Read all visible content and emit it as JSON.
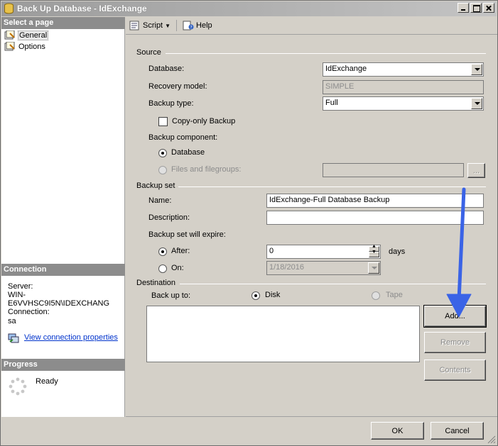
{
  "window": {
    "title": "Back Up Database - IdExchange"
  },
  "left": {
    "select_page_header": "Select a page",
    "pages": [
      {
        "label": "General",
        "icon": "page-icon",
        "selected": true
      },
      {
        "label": "Options",
        "icon": "page-icon",
        "selected": false
      }
    ],
    "connection_header": "Connection",
    "server_label": "Server:",
    "server_value": "WIN-E6VVHSC9I5N\\IDEXCHANG",
    "connection_label": "Connection:",
    "connection_value": "sa",
    "view_connection_link": "View connection properties",
    "progress_header": "Progress",
    "progress_status": "Ready"
  },
  "toolbar": {
    "script_label": "Script",
    "help_label": "Help"
  },
  "source": {
    "section_label": "Source",
    "database_label": "Database:",
    "database_value": "IdExchange",
    "recovery_model_label": "Recovery model:",
    "recovery_model_value": "SIMPLE",
    "backup_type_label": "Backup type:",
    "backup_type_value": "Full",
    "copy_only_label": "Copy-only Backup",
    "backup_component_label": "Backup component:",
    "database_radio_label": "Database",
    "files_radio_label": "Files and filegroups:",
    "browse_label": "..."
  },
  "backup_set": {
    "section_label": "Backup set",
    "name_label": "Name:",
    "name_value": "IdExchange-Full Database Backup",
    "description_label": "Description:",
    "description_value": "",
    "expire_label": "Backup set will expire:",
    "after_label": "After:",
    "after_value": "0",
    "days_label": "days",
    "on_label": "On:",
    "on_value": "1/18/2016"
  },
  "destination": {
    "section_label": "Destination",
    "back_up_to_label": "Back up to:",
    "disk_label": "Disk",
    "tape_label": "Tape",
    "add_label": "Add...",
    "remove_label": "Remove",
    "contents_label": "Contents"
  },
  "footer": {
    "ok_label": "OK",
    "cancel_label": "Cancel"
  },
  "colors": {
    "annotation_arrow": "#3a63e6",
    "link": "#0033cc",
    "section_header": "#8c8c8c"
  }
}
